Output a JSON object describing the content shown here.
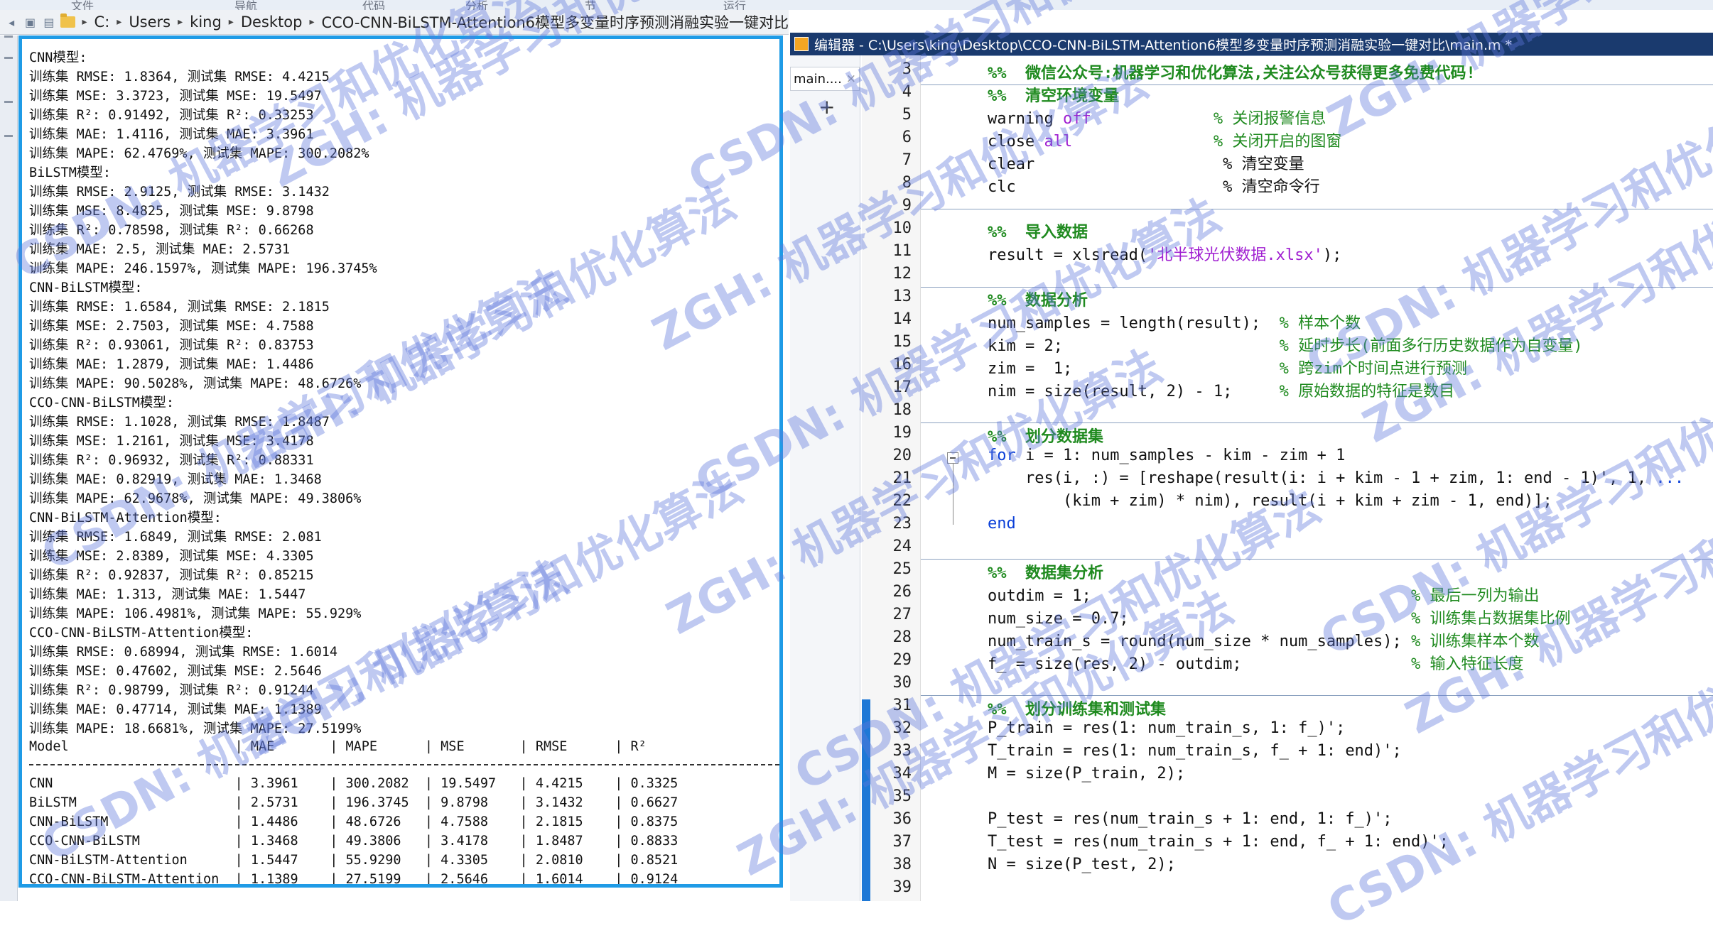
{
  "top_menu": [
    "文件",
    "导航",
    "代码",
    "分析",
    "节",
    "运行"
  ],
  "breadcrumb": [
    "C:",
    "Users",
    "king",
    "Desktop",
    "CCO-CNN-BiLSTM-Attention6模型多变量时序预测消融实验一键对比"
  ],
  "command_window": {
    "lines": [
      "CNN模型:",
      "训练集 RMSE: 1.8364, 测试集 RMSE: 4.4215",
      "训练集 MSE: 3.3723, 测试集 MSE: 19.5497",
      "训练集 R²: 0.91492, 测试集 R²: 0.33253",
      "训练集 MAE: 1.4116, 测试集 MAE: 3.3961",
      "训练集 MAPE: 62.4769%, 测试集 MAPE: 300.2082%",
      "BiLSTM模型:",
      "训练集 RMSE: 2.9125, 测试集 RMSE: 3.1432",
      "训练集 MSE: 8.4825, 测试集 MSE: 9.8798",
      "训练集 R²: 0.78598, 测试集 R²: 0.66268",
      "训练集 MAE: 2.5, 测试集 MAE: 2.5731",
      "训练集 MAPE: 246.1597%, 测试集 MAPE: 196.3745%",
      "CNN-BiLSTM模型:",
      "训练集 RMSE: 1.6584, 测试集 RMSE: 2.1815",
      "训练集 MSE: 2.7503, 测试集 MSE: 4.7588",
      "训练集 R²: 0.93061, 测试集 R²: 0.83753",
      "训练集 MAE: 1.2879, 测试集 MAE: 1.4486",
      "训练集 MAPE: 90.5028%, 测试集 MAPE: 48.6726%",
      "CCO-CNN-BiLSTM模型:",
      "训练集 RMSE: 1.1028, 测试集 RMSE: 1.8487",
      "训练集 MSE: 1.2161, 测试集 MSE: 3.4178",
      "训练集 R²: 0.96932, 测试集 R²: 0.88331",
      "训练集 MAE: 0.82919, 测试集 MAE: 1.3468",
      "训练集 MAPE: 62.9678%, 测试集 MAPE: 49.3806%",
      "CNN-BiLSTM-Attention模型:",
      "训练集 RMSE: 1.6849, 测试集 RMSE: 2.081",
      "训练集 MSE: 2.8389, 测试集 MSE: 4.3305",
      "训练集 R²: 0.92837, 测试集 R²: 0.85215",
      "训练集 MAE: 1.313, 测试集 MAE: 1.5447",
      "训练集 MAPE: 106.4981%, 测试集 MAPE: 55.929%",
      "CCO-CNN-BiLSTM-Attention模型:",
      "训练集 RMSE: 0.68994, 测试集 RMSE: 1.6014",
      "训练集 MSE: 0.47602, 测试集 MSE: 2.5646",
      "训练集 R²: 0.98799, 测试集 R²: 0.91244",
      "训练集 MAE: 0.47714, 测试集 MAE: 1.1389",
      "训练集 MAPE: 18.6681%, 测试集 MAPE: 27.5199%"
    ],
    "table_header": "Model                     | MAE       | MAPE      | MSE       | RMSE      | R²",
    "table_rows": [
      "CNN                       | 3.3961    | 300.2082  | 19.5497   | 4.4215    | 0.3325",
      "BiLSTM                    | 2.5731    | 196.3745  | 9.8798    | 3.1432    | 0.6627",
      "CNN-BiLSTM                | 1.4486    | 48.6726   | 4.7588    | 2.1815    | 0.8375",
      "CCO-CNN-BiLSTM            | 1.3468    | 49.3806   | 3.4178    | 1.8487    | 0.8833",
      "CNN-BiLSTM-Attention      | 1.5447    | 55.9290   | 4.3305    | 2.0810    | 0.8521",
      "CCO-CNN-BiLSTM-Attention  | 1.1389    | 27.5199   | 2.5646    | 1.6014    | 0.9124"
    ]
  },
  "editor": {
    "title": "编辑器 - C:\\Users\\king\\Desktop\\CCO-CNN-BiLSTM-Attention6模型多变量时序预测消融实验一键对比\\main.m *",
    "tab_label": "main....",
    "tab_close": "×",
    "add_tab": "+",
    "line_numbers": [
      "3",
      "4",
      "5",
      "6",
      "7",
      "8",
      "9",
      "10",
      "11",
      "12",
      "13",
      "14",
      "15",
      "16",
      "17",
      "18",
      "19",
      "20",
      "21",
      "22",
      "23",
      "24",
      "25",
      "26",
      "27",
      "28",
      "29",
      "30",
      "31",
      "32",
      "33",
      "34",
      "35",
      "36",
      "37",
      "38",
      "39"
    ],
    "code": {
      "l3": "%%  微信公众号:机器学习和优化算法,关注公众号获得更多免费代码!",
      "l4": "%%  清空环境变量",
      "l5a": "warning ",
      "l5b": "off",
      "l5c": "             % 关闭报警信息",
      "l6a": "close ",
      "l6b": "all",
      "l6c": "               % 关闭开启的图窗",
      "l7": "clear                    % 清空变量",
      "l8": "clc                      % 清空命令行",
      "l10": "%%  导入数据",
      "l11a": "result = xlsread(",
      "l11b": "'北半球光伏数据.xlsx'",
      "l11c": ");",
      "l13": "%%  数据分析",
      "l14a": "num_samples = length(result);  ",
      "l14b": "% 样本个数",
      "l15a": "kim = 2;                       ",
      "l15b": "% 延时步长(前面多行历史数据作为自变量)",
      "l16a": "zim =  1;                      ",
      "l16b": "% 跨zim个时间点进行预测",
      "l17a": "nim = size(result, 2) - 1;     ",
      "l17b": "% 原始数据的特征是数目",
      "l19": "%%  划分数据集",
      "l20a": "for",
      "l20b": " i = 1: num_samples - kim - zim + 1",
      "l21a": "    res(i, :) = [reshape(result(i: i + kim - 1 + zim, 1: end - 1)', 1, ",
      "l21b": "...",
      "l22": "        (kim + zim) * nim), result(i + kim + zim - 1, end)];",
      "l23": "end",
      "l25": "%%  数据集分析",
      "l26a": "outdim = 1;                                  ",
      "l26b": "% 最后一列为输出",
      "l27a": "num_size = 0.7;                              ",
      "l27b": "% 训练集占数据集比例",
      "l28a": "num_train_s = round(num_size * num_samples); ",
      "l28b": "% 训练集样本个数",
      "l29a": "f_ = size(res, 2) - outdim;                  ",
      "l29b": "% 输入特征长度",
      "l31": "%%  划分训练集和测试集",
      "l32": "P_train = res(1: num_train_s, 1: f_)';",
      "l33": "T_train = res(1: num_train_s, f_ + 1: end)';",
      "l34": "M = size(P_train, 2);",
      "l36": "P_test = res(num_train_s + 1: end, 1: f_)';",
      "l37": "T_test = res(num_train_s + 1: end, f_ + 1: end)';",
      "l38": "N = size(P_test, 2);"
    }
  },
  "watermarks": {
    "zgh": "ZGH: 机器学习和优化算法",
    "csdn": "CSDN: 机器学习和优化算法"
  }
}
